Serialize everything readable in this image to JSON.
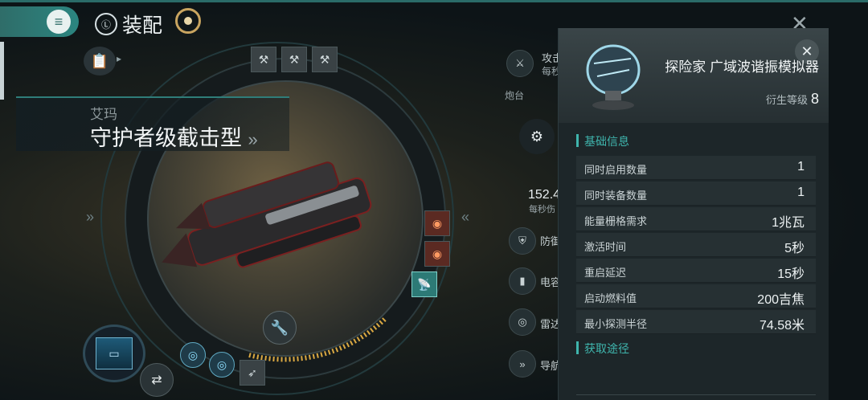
{
  "header": {
    "title": "装配",
    "menu_icon": "menu-icon",
    "target_icon": "target-icon"
  },
  "ship": {
    "faction": "艾玛",
    "name": "守护者级截击型",
    "name_suffix": "»"
  },
  "fitting": {
    "high_slots": [
      "turret",
      "turret",
      "turret"
    ],
    "mid_slots": [
      "module-red",
      "module-red",
      "module-selected"
    ],
    "rig_slots": [
      "rig",
      "rig",
      "rig"
    ]
  },
  "stats": {
    "attack_label": "攻击",
    "per_sec_label": "每秒",
    "turret_label": "炮台",
    "dps_value": "152.4",
    "dps_label": "每秒伤",
    "defense_label": "防御",
    "capacitor_label": "电容",
    "radar_label": "雷达",
    "nav_label": "导航"
  },
  "info": {
    "module_name": "探险家 广域波谐振模拟器",
    "meta_label": "衍生等级",
    "meta_value": "8",
    "basic_title": "基础信息",
    "attributes": [
      {
        "k": "同时启用数量",
        "v": "1"
      },
      {
        "k": "同时装备数量",
        "v": "1"
      },
      {
        "k": "能量栅格需求",
        "v": "1兆瓦"
      },
      {
        "k": "激活时间",
        "v": "5秒"
      },
      {
        "k": "重启延迟",
        "v": "15秒"
      },
      {
        "k": "启动燃料值",
        "v": "200吉焦"
      },
      {
        "k": "最小探测半径",
        "v": "74.58米"
      }
    ],
    "source_title": "获取途径"
  },
  "colors": {
    "accent": "#3fb5ad",
    "menu": "#2f6d69",
    "gold": "#c9a560"
  }
}
